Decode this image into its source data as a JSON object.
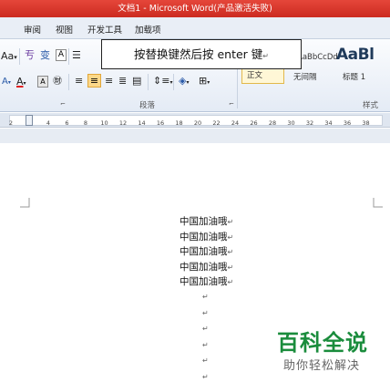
{
  "window": {
    "title": "文档1 - Microsoft Word(产品激活失败)"
  },
  "ribbon_tabs": [
    "审阅",
    "视图",
    "开发工具",
    "加载项"
  ],
  "callout": {
    "text": "按替换键然后按 enter 键"
  },
  "ribbon": {
    "font_size_label": "Aa",
    "paragraph_group_label": "段落",
    "styles_group_label": "样式",
    "styles": [
      {
        "sample": "AaBbCcDd",
        "name": "正文",
        "selected": true
      },
      {
        "sample": "AaBbCcDd",
        "name": "无间隔",
        "selected": false
      },
      {
        "sample": "AaBl",
        "name": "标题 1",
        "selected": false
      }
    ],
    "font_color_letter": "A",
    "char_button": "字",
    "paragraph_mark": "¶"
  },
  "ruler": {
    "numbers": [
      "2",
      "2",
      "4",
      "6",
      "8",
      "10",
      "12",
      "14",
      "16",
      "18",
      "20",
      "22",
      "24",
      "26",
      "28",
      "30",
      "32",
      "34",
      "36",
      "38"
    ]
  },
  "document": {
    "lines": [
      "中国加油哦",
      "中国加油哦",
      "中国加油哦",
      "中国加油哦",
      "中国加油哦"
    ],
    "paragraph_mark": "↵",
    "empty_paragraphs": 6
  },
  "watermark": {
    "main": "百科全说",
    "sub": "助你轻松解决"
  },
  "colors": {
    "title_bar": "#d93a2f",
    "ribbon_bg": "#e4ebf5",
    "watermark_green": "#1a8c3c"
  }
}
